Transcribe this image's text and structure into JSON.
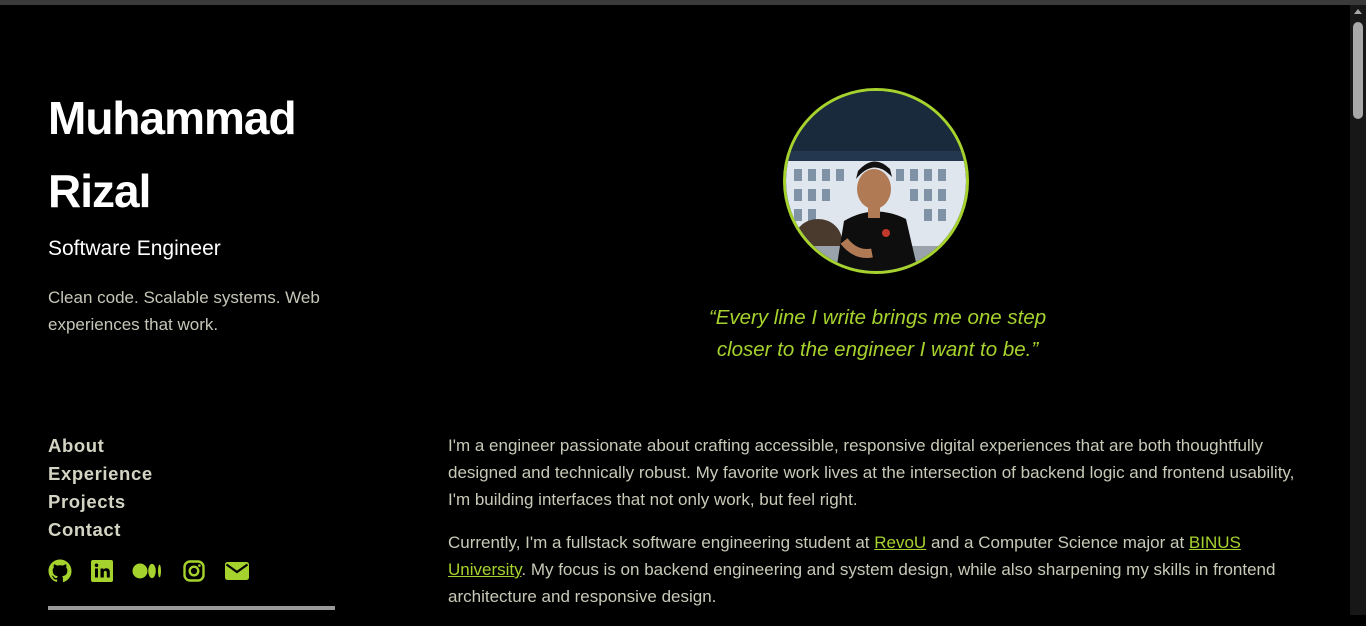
{
  "profile": {
    "name_line1": "Muhammad",
    "name_line2": "Rizal",
    "role": "Software Engineer",
    "tagline": "Clean code. Scalable systems. Web experiences that work."
  },
  "nav": {
    "items": [
      {
        "label": "About"
      },
      {
        "label": "Experience"
      },
      {
        "label": "Projects"
      },
      {
        "label": "Contact"
      }
    ]
  },
  "socials": {
    "icons": [
      "github-icon",
      "linkedin-icon",
      "medium-icon",
      "instagram-icon",
      "email-icon"
    ],
    "color": "#a6d22e"
  },
  "quote": {
    "line1": "“Every line I write brings me one step",
    "line2": "closer to the engineer I want to be.”"
  },
  "about": {
    "p1": "I'm a engineer passionate about crafting accessible, responsive digital experiences that are both thoughtfully designed and technically robust. My favorite work lives at the intersection of backend logic and frontend usability, I'm building interfaces that not only work, but feel right.",
    "p2_a": "Currently, I'm a fullstack software engineering student at ",
    "p2_link1": "RevoU",
    "p2_b": " and a Computer Science major at ",
    "p2_link2": "BINUS University",
    "p2_c": ". My focus is on backend engineering and system design, while also sharpening my skills in frontend architecture and responsive design."
  },
  "theme": {
    "background": "#000000",
    "accent": "#a6d22e",
    "text": "#c9c9b8"
  }
}
